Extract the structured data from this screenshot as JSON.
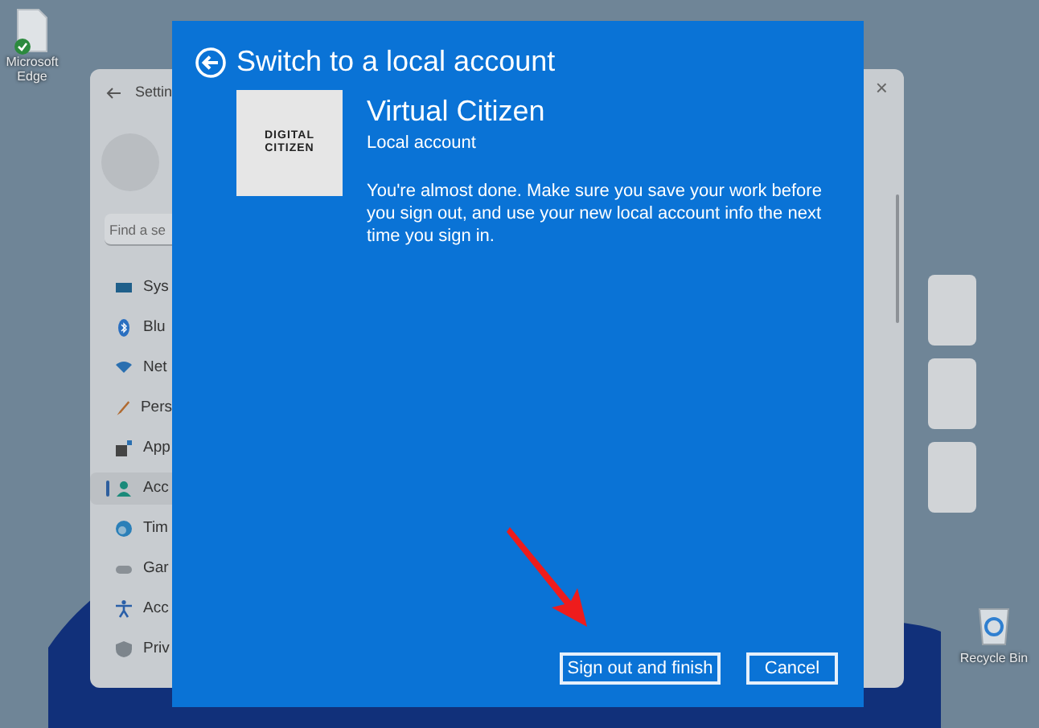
{
  "desktop_icons": [
    {
      "label": "Microsoft Edge",
      "kind": "file"
    },
    {
      "label": "Recycle Bin",
      "kind": "bin"
    }
  ],
  "settings_window": {
    "title": "Settin",
    "search": {
      "placeholder": "Find a se"
    },
    "close": "×",
    "sidebar": {
      "items": [
        {
          "label": "Sys",
          "kind": "system",
          "selected": false
        },
        {
          "label": "Blu",
          "kind": "bluetooth",
          "selected": false
        },
        {
          "label": "Net",
          "kind": "network",
          "selected": false
        },
        {
          "label": "Pers",
          "kind": "brush",
          "selected": false
        },
        {
          "label": "App",
          "kind": "apps",
          "selected": false
        },
        {
          "label": "Acc",
          "kind": "person",
          "selected": true
        },
        {
          "label": "Tim",
          "kind": "globe",
          "selected": false
        },
        {
          "label": "Gar",
          "kind": "gamepad",
          "selected": false
        },
        {
          "label": "Acc",
          "kind": "accessibility",
          "selected": false
        },
        {
          "label": "Priv",
          "kind": "shield",
          "selected": false
        }
      ]
    }
  },
  "dialog": {
    "title": "Switch to a local account",
    "logo": [
      "DIGITAL",
      "CITIZEN"
    ],
    "account_name": "Virtual Citizen",
    "account_type": "Local account",
    "message": "You're almost done. Make sure you save your work before you sign out, and use your new local account info the next time you sign in.",
    "buttons": [
      "Sign out and finish",
      "Cancel"
    ]
  }
}
